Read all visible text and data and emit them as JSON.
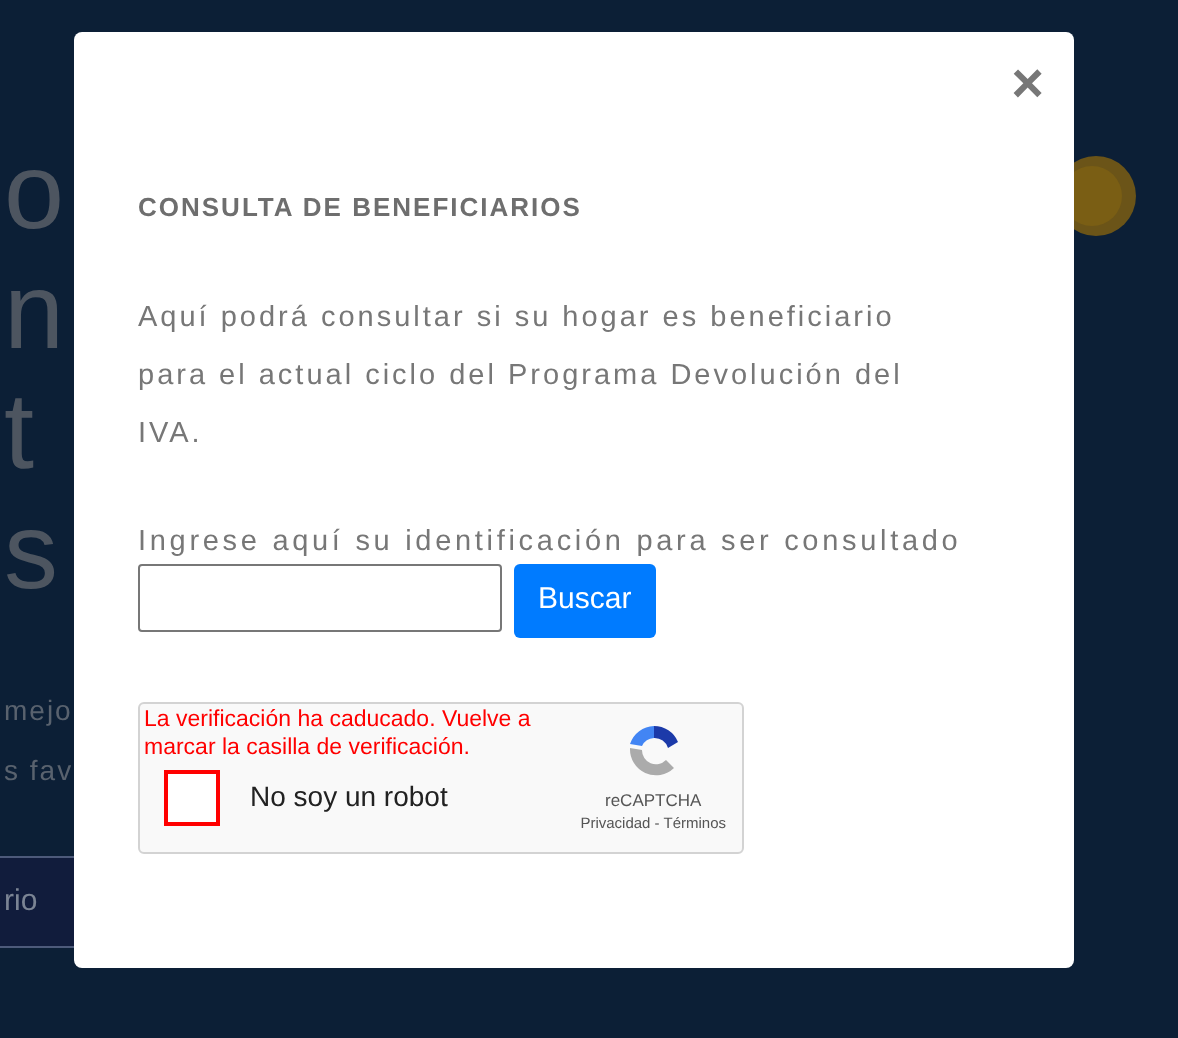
{
  "background": {
    "heading_lines": [
      "o",
      "n",
      "t",
      "s"
    ],
    "text_lines": [
      "mejo",
      "s fav"
    ],
    "button": "rio"
  },
  "modal": {
    "close": "×",
    "title": "CONSULTA DE BENEFICIARIOS",
    "description": "Aquí podrá consultar si su hogar es beneficiario para el actual ciclo del Programa Devolución del IVA.",
    "field_label": "Ingrese aquí su identificación para ser consultado",
    "search_button": "Buscar",
    "captcha": {
      "error": "La verificación ha caducado. Vuelve a marcar la casilla de verificación.",
      "checked": false,
      "label": "No soy un robot",
      "brand": "reCAPTCHA",
      "links": "Privacidad - Términos"
    }
  }
}
